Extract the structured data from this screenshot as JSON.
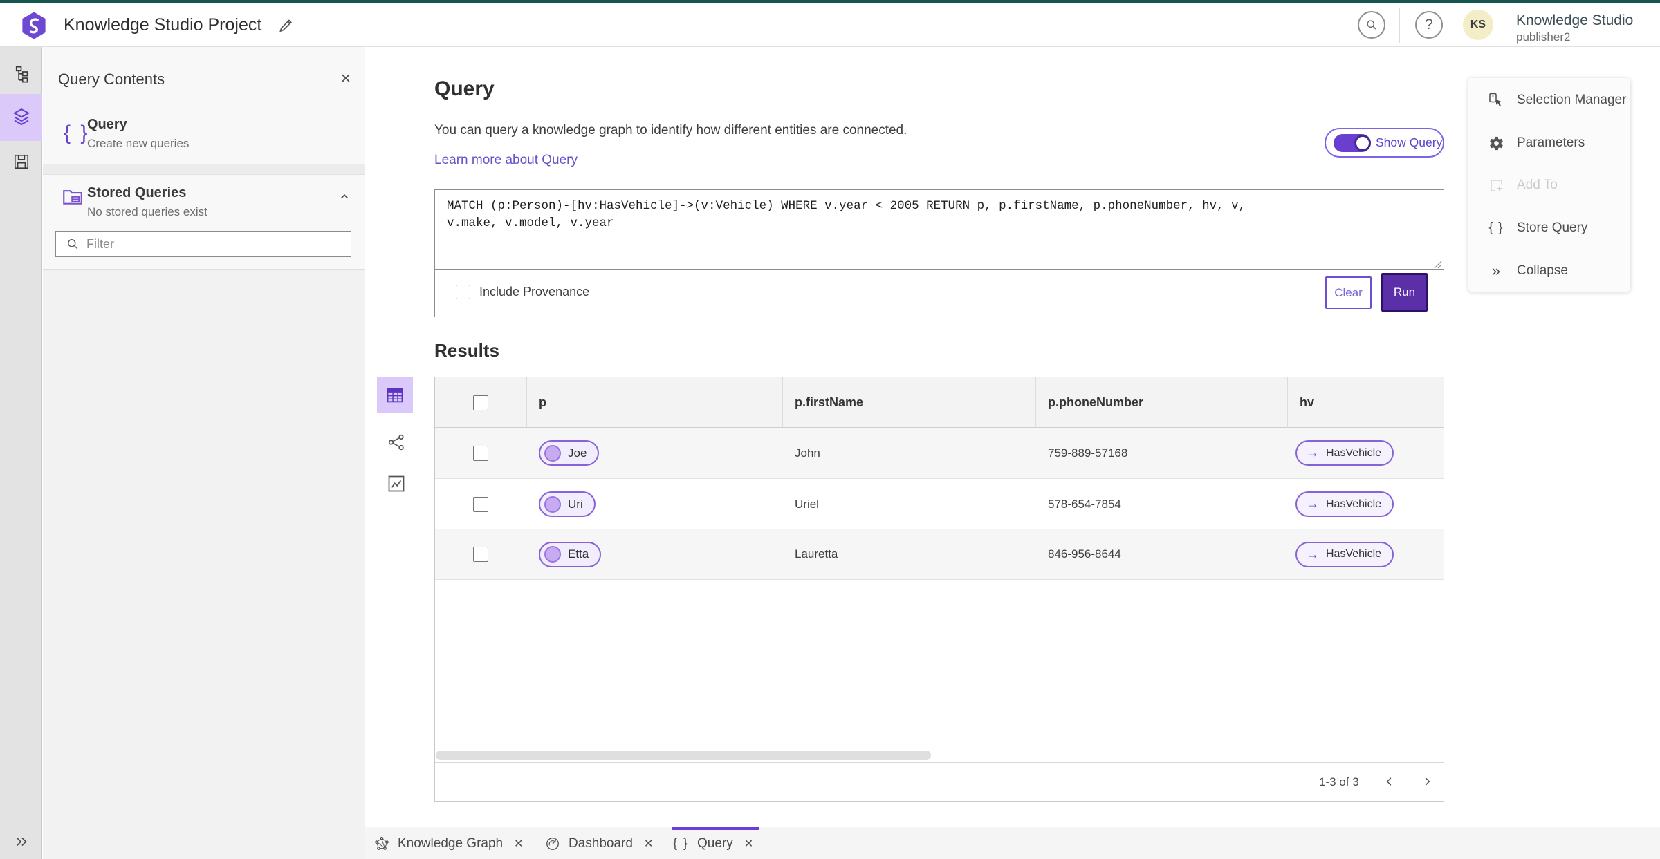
{
  "header": {
    "app_title": "Knowledge Studio Project",
    "account_name": "Knowledge Studio",
    "account_user": "publisher2",
    "avatar_initials": "KS"
  },
  "panel": {
    "title": "Query Contents",
    "close_glyph": "✕",
    "query_item": {
      "title": "Query",
      "subtitle": "Create new queries"
    },
    "stored_item": {
      "title": "Stored Queries",
      "subtitle": "No stored queries exist"
    },
    "filter_placeholder": "Filter",
    "braces_glyph": "{ }"
  },
  "query": {
    "heading": "Query",
    "description": "You can query a knowledge graph to identify how different entities are connected.",
    "link": "Learn more about Query",
    "toggle_label": "Show Query",
    "text": "MATCH (p:Person)-[hv:HasVehicle]->(v:Vehicle) WHERE v.year < 2005 RETURN p, p.firstName, p.phoneNumber, hv, v,\nv.make, v.model, v.year",
    "include_provenance": "Include Provenance",
    "clear_label": "Clear",
    "run_label": "Run"
  },
  "results": {
    "heading": "Results",
    "columns": {
      "c1": "p",
      "c2": "p.firstName",
      "c3": "p.phoneNumber",
      "c4": "hv"
    },
    "rows": [
      {
        "p": "Joe",
        "firstName": "John",
        "phone": "759-889-57168",
        "hv": "HasVehicle"
      },
      {
        "p": "Uri",
        "firstName": "Uriel",
        "phone": "578-654-7854",
        "hv": "HasVehicle"
      },
      {
        "p": "Etta",
        "firstName": "Lauretta",
        "phone": "846-956-8644",
        "hv": "HasVehicle"
      }
    ],
    "hv_arrow": "→",
    "pagination": "1-3 of 3"
  },
  "right_menu": {
    "selection_manager": "Selection Manager",
    "parameters": "Parameters",
    "add_to": "Add To",
    "store_query": "Store Query",
    "collapse": "Collapse",
    "braces_glyph": "{ }",
    "collapse_glyph": "»"
  },
  "tabs": {
    "t1": "Knowledge Graph",
    "t2": "Dashboard",
    "t3": "Query",
    "close_glyph": "✕",
    "braces_glyph": "{ }"
  }
}
